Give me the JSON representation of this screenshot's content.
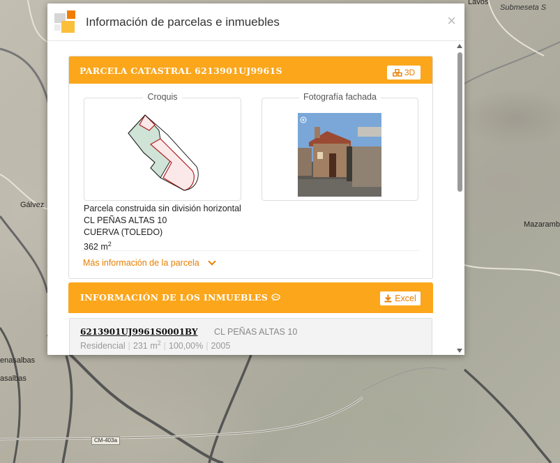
{
  "map": {
    "labels": {
      "lavos": "Lavos",
      "submesera": "Submeseta S",
      "galvez": "Gálvez",
      "mazaramb": "Mazaramb",
      "menasalbas1": "enasalbas",
      "menasalbas2": "asalbas",
      "road": "CM-403a"
    }
  },
  "modal": {
    "title": "Información de parcelas e inmuebles",
    "close": "×"
  },
  "parcel": {
    "header": "PARCELA CATASTRAL 6213901UJ9961S",
    "btn_3d": "3D",
    "croquis_label": "Croquis",
    "foto_label": "Fotografía fachada",
    "type": "Parcela construida sin división horizontal",
    "address": "CL PEÑAS ALTAS 10",
    "municipality": "CUERVA (TOLEDO)",
    "area": "362 m",
    "area_unit_sup": "2",
    "more_info": "Más información de la parcela"
  },
  "inmuebles": {
    "header": "INFORMACIÓN DE LOS INMUEBLES",
    "excel_label": "Excel",
    "items": [
      {
        "ref": "6213901UJ9961S0001BY",
        "address": "CL PEÑAS ALTAS 10",
        "use": "Residencial",
        "surface": "231 m",
        "surface_sup": "2",
        "percent": "100,00%",
        "year": "2005"
      }
    ]
  },
  "colors": {
    "accent": "#fba61b",
    "accent_text": "#e67e00"
  }
}
